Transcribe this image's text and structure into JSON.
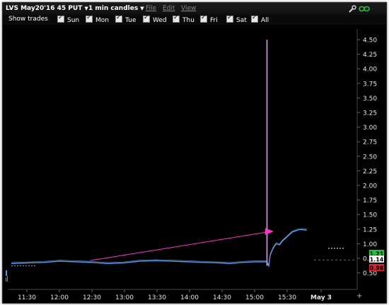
{
  "window": {
    "contract": "LVS May20'16 45 PUT",
    "interval": "1 min candles",
    "menus": [
      "File",
      "Edit",
      "View"
    ]
  },
  "toolbar": {
    "show_trades_label": "Show trades",
    "days": [
      "Sun",
      "Mon",
      "Tue",
      "Wed",
      "Thu",
      "Fri",
      "Sat",
      "All"
    ]
  },
  "icons": [
    "wrench-icon",
    "link-icon",
    "dropdown-caret-icon",
    "checkbox-icon",
    "scroll-icon",
    "plus-icon"
  ],
  "colors": {
    "background": "#000000",
    "price_line": "#4aa3f0",
    "trend_line": "#ff33cc",
    "bid_tag": "#22c23a",
    "ask_tag": "#e0202a",
    "spike": "#c98ed6"
  },
  "chart_data": {
    "type": "line",
    "x_ticks": [
      "11:30",
      "12:00",
      "12:30",
      "13:00",
      "13:30",
      "14:00",
      "14:30",
      "15:00",
      "15:30",
      "May 3"
    ],
    "y_ticks": [
      "4.50",
      "4.25",
      "4.00",
      "3.75",
      "3.50",
      "3.25",
      "3.00",
      "2.75",
      "2.50",
      "2.25",
      "2.00",
      "1.75",
      "1.50",
      "1.25",
      "1.00",
      "0.75",
      "0.50"
    ],
    "ylim": [
      0.4,
      4.55
    ],
    "x_range": [
      0,
      100
    ],
    "series": [
      {
        "values": [
          [
            0,
            0.66
          ],
          [
            5,
            0.67
          ],
          [
            10,
            0.68
          ],
          [
            15,
            0.7
          ],
          [
            20,
            0.69
          ],
          [
            25,
            0.68
          ],
          [
            30,
            0.66
          ],
          [
            35,
            0.67
          ],
          [
            40,
            0.7
          ],
          [
            45,
            0.71
          ],
          [
            50,
            0.7
          ],
          [
            55,
            0.69
          ],
          [
            60,
            0.68
          ],
          [
            65,
            0.67
          ],
          [
            68,
            0.66
          ],
          [
            72,
            0.68
          ],
          [
            76,
            0.69
          ],
          [
            79.5,
            0.69
          ],
          [
            80.2,
            0.62
          ],
          [
            80.6,
            0.8
          ],
          [
            81.5,
            0.92
          ],
          [
            82.5,
            1.0
          ],
          [
            83.5,
            0.98
          ],
          [
            84.5,
            1.05
          ],
          [
            85.5,
            1.1
          ],
          [
            86.5,
            1.15
          ],
          [
            87.5,
            1.2
          ],
          [
            88.5,
            1.22
          ],
          [
            89.5,
            1.24
          ],
          [
            91,
            1.24
          ],
          [
            92,
            1.23
          ]
        ]
      }
    ],
    "spike": {
      "x": 79.6,
      "high": 4.5,
      "low": 0.62
    },
    "trend_line": {
      "from": [
        24.5,
        0.71
      ],
      "to": [
        80.8,
        1.21
      ]
    },
    "dashed_levels": [
      0.72,
      0.92,
      0.62
    ],
    "price_tags": [
      {
        "value": "1.21",
        "color": "#22c23a"
      },
      {
        "value": "1.14",
        "color": "#ffffff"
      },
      {
        "value": "0.98",
        "color": "#e0202a"
      }
    ]
  }
}
